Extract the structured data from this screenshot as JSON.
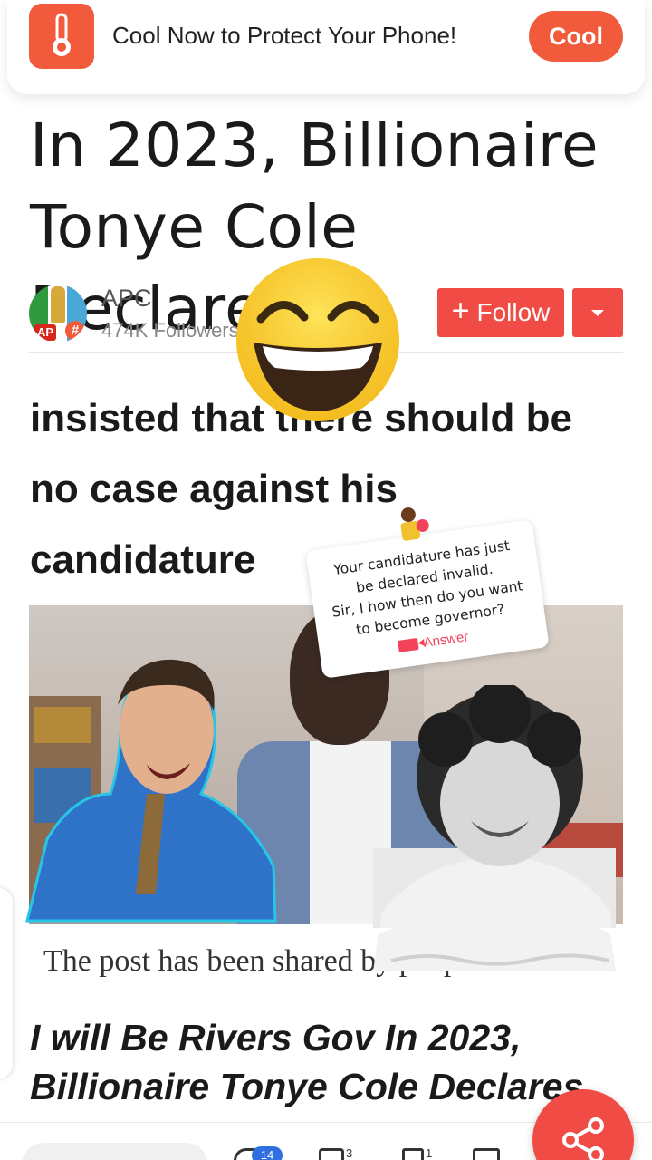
{
  "banner": {
    "text": "Cool Now to Protect Your Phone!",
    "button_label": "Cool",
    "icon": "thermometer-icon",
    "accent_color": "#f25a3c"
  },
  "article": {
    "headline_line1": "In 2023, Billionaire",
    "headline_line2": "Tonye Cole Declares",
    "author": {
      "name": "APC",
      "followers": "474K Followers",
      "avatar_label": "AP",
      "avatar_badge": "#"
    },
    "follow_label": "Follow",
    "body_line1": "insisted that there should be",
    "body_line2": "no case against his",
    "body_line3": "candidature",
    "share_notice": "The post has been shared by people",
    "related_title_line1": "I will Be Rivers Gov In 2023,",
    "related_title_line2": "Billionaire Tonye Cole Declares"
  },
  "question_sticker": {
    "text_line1": "Your candidature has just",
    "text_line2": "be declared invalid.",
    "text_line3": "Sir, I how then do you want",
    "text_line4": "to become governor?",
    "answer_label": "Answer",
    "accent_color": "#f2435a"
  },
  "bottom_bar": {
    "comment_badge": "14",
    "like_count": "3",
    "bookmark_count": "1"
  },
  "colors": {
    "follow_button": "#f04c45",
    "badge_blue": "#2f6fe0"
  }
}
